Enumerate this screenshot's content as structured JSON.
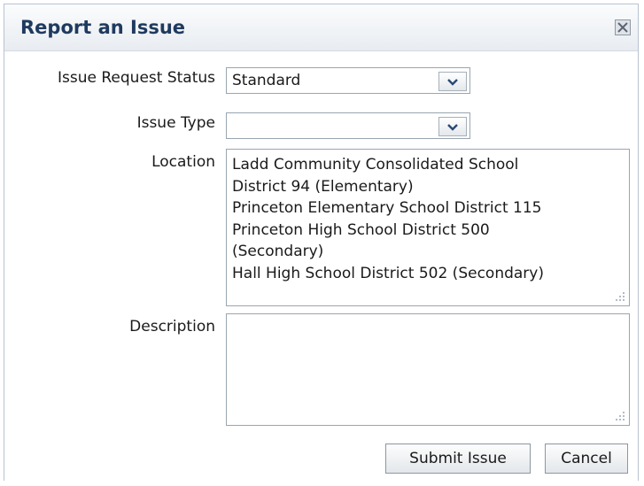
{
  "dialog": {
    "title": "Report an Issue",
    "close_icon": "close-icon"
  },
  "form": {
    "status_label": "Issue Request Status",
    "status_value": "Standard",
    "type_label": "Issue Type",
    "type_value": "",
    "location_label": "Location",
    "location_lines": [
      "Ladd Community Consolidated School",
      "District 94 (Elementary)",
      "Princeton Elementary School District 115",
      "Princeton High School District 500",
      "(Secondary)",
      "Hall High School District 502 (Secondary)"
    ],
    "description_label": "Description",
    "description_value": ""
  },
  "buttons": {
    "submit_label": "Submit Issue",
    "cancel_label": "Cancel"
  },
  "colors": {
    "title": "#1f3a5f",
    "border": "#9aa5b1"
  }
}
